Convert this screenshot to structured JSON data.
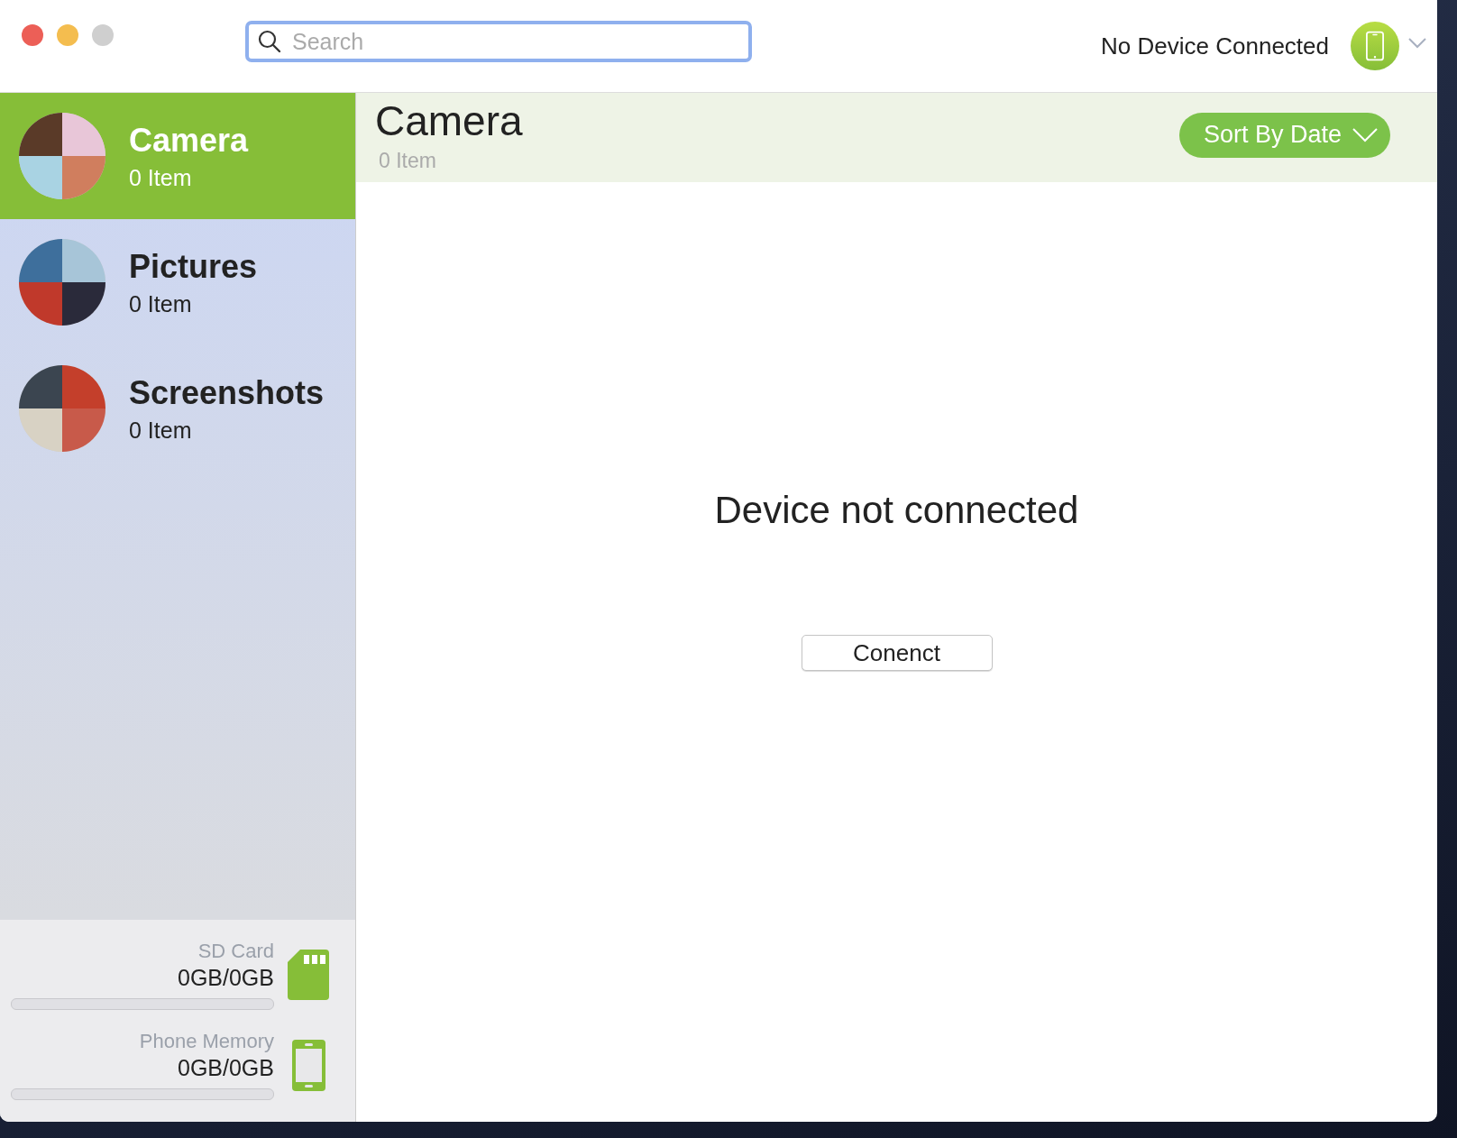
{
  "toolbar": {
    "search": {
      "placeholder": "Search"
    },
    "device_status": "No Device Connected"
  },
  "sidebar": {
    "items": [
      {
        "title": "Camera",
        "count": "0 Item",
        "selected": true
      },
      {
        "title": "Pictures",
        "count": "0 Item",
        "selected": false
      },
      {
        "title": "Screenshots",
        "count": "0 Item",
        "selected": false
      }
    ],
    "storage": [
      {
        "kind": "sdcard",
        "label": "SD Card",
        "usage": "0GB/0GB"
      },
      {
        "kind": "phone",
        "label": "Phone Memory",
        "usage": "0GB/0GB"
      }
    ]
  },
  "content": {
    "title": "Camera",
    "count": "0 Item",
    "sort_button": "Sort By Date",
    "message": "Device not connected",
    "connect_button": "Conenct"
  }
}
